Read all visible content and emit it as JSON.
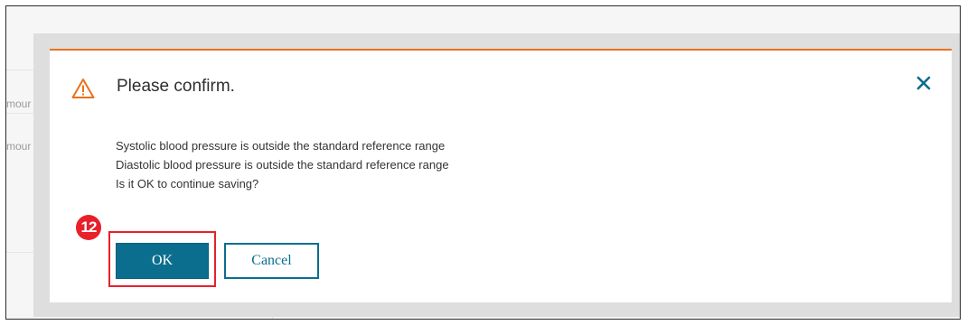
{
  "background": {
    "field_fragments": [
      "mour",
      "mour"
    ]
  },
  "dialog": {
    "icon": "warning-triangle-icon",
    "title": "Please confirm.",
    "close_icon": "close-x-icon",
    "messages": [
      "Systolic blood pressure is outside the standard reference range",
      "Diastolic blood pressure is outside the standard reference range",
      "Is it OK to continue saving?"
    ],
    "ok_label": "OK",
    "cancel_label": "Cancel"
  },
  "annotation": {
    "step_number": "12"
  },
  "colors": {
    "accent_orange": "#e9711c",
    "primary_teal": "#0b6e8e",
    "annotation_red": "#e8202a"
  }
}
